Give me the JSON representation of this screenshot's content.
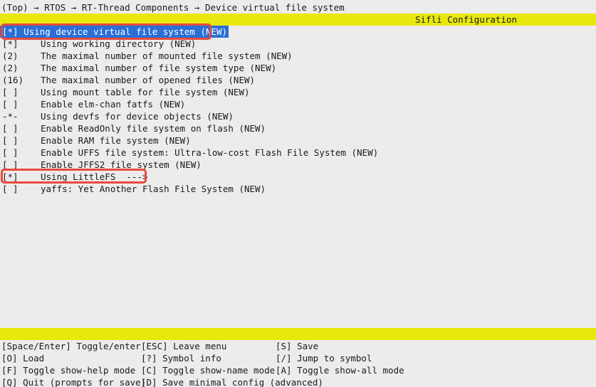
{
  "breadcrumb": "(Top) → RTOS → RT-Thread Components → Device virtual file system",
  "window_title": "Sifli Configuration",
  "menu": [
    {
      "mark": "[*]",
      "label": "Using device virtual file system (NEW)",
      "selected": true
    },
    {
      "mark": "[*]",
      "label": "Using working directory (NEW)"
    },
    {
      "mark": "(2)",
      "label": "The maximal number of mounted file system (NEW)"
    },
    {
      "mark": "(2)",
      "label": "The maximal number of file system type (NEW)"
    },
    {
      "mark": "(16)",
      "label": "The maximal number of opened files (NEW)"
    },
    {
      "mark": "[ ]",
      "label": "Using mount table for file system (NEW)"
    },
    {
      "mark": "[ ]",
      "label": "Enable elm-chan fatfs (NEW)"
    },
    {
      "mark": "-*-",
      "label": "Using devfs for device objects (NEW)"
    },
    {
      "mark": "[ ]",
      "label": "Enable ReadOnly file system on flash (NEW)"
    },
    {
      "mark": "[ ]",
      "label": "Enable RAM file system (NEW)"
    },
    {
      "mark": "[ ]",
      "label": "Enable UFFS file system: Ultra-low-cost Flash File System (NEW)"
    },
    {
      "mark": "[ ]",
      "label": "Enable JFFS2 file system (NEW)"
    },
    {
      "mark": "[*]",
      "label": "Using LittleFS  --->"
    },
    {
      "mark": "[ ]",
      "label": "yaffs: Yet Another Flash File System (NEW)"
    }
  ],
  "help": {
    "row1": {
      "a": "[Space/Enter] Toggle/enter",
      "b": "[ESC] Leave menu",
      "c": "[S] Save"
    },
    "row2": {
      "a": "[O] Load",
      "b": "[?] Symbol info",
      "c": "[/] Jump to symbol"
    },
    "row3": {
      "a": "[F] Toggle show-help mode",
      "b": "[C] Toggle show-name mode",
      "c": "[A] Toggle show-all mode"
    },
    "row4": {
      "a": "[Q] Quit (prompts for save)",
      "b": "[D] Save minimal config (advanced)"
    }
  },
  "colors": {
    "bar": "#e8e80e",
    "selection": "#2a6fd6",
    "annotation": "#e84a3c",
    "background": "#ececec"
  }
}
